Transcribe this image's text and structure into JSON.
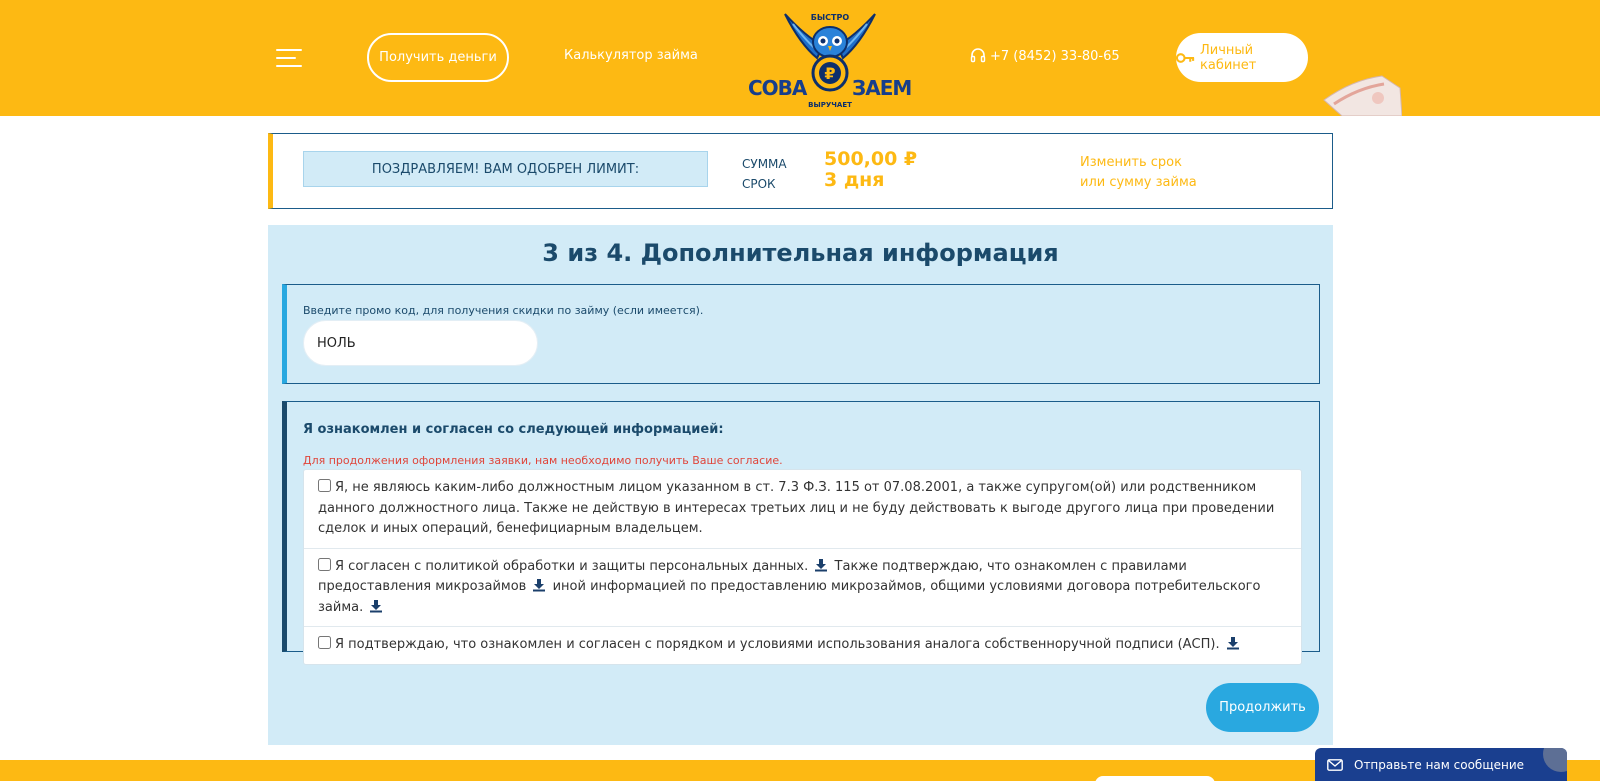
{
  "header": {
    "get_money_label": "Получить деньги",
    "calc_label": "Калькулятор займа",
    "logo": {
      "top": "БЫСТРО",
      "left": "СОВА",
      "right": "ЗАЕМ",
      "bottom": "ВЫРУЧАЕТ",
      "coin": "₽"
    },
    "phone": "+7 (8452) 33-80-65",
    "cabinet_label": "Личный кабинет"
  },
  "limit": {
    "badge": "ПОЗДРАВЛЯЕМ! ВАМ ОДОБРЕН ЛИМИТ:",
    "sum_label": "СУММА",
    "term_label": "СРОК",
    "sum_value": "500,00 ₽",
    "term_value": "3 дня",
    "change_line1": "Изменить срок",
    "change_line2": "или сумму займа"
  },
  "form": {
    "step_title": "3 из 4. Дополнительная информация",
    "promo_label": "Введите промо код, для получения скидки по займу (если имеется).",
    "promo_value": "НОЛЬ",
    "agree_title": "Я ознакомлен и согласен со следующей информацией:",
    "agree_warning": "Для продолжения оформления заявки, нам необходимо получить Ваше согласие.",
    "agree_items": [
      {
        "text": "Я, не являюсь каким-либо должностным лицом указанном в ст. 7.3 Ф.З. 115 от 07.08.2001, а также супругом(ой) или родственником данного должностного лица. Также не действую в интересах третьих лиц и не буду действовать к выгоде другого лица при проведении сделок и иных операций, бенефициарным владельцем."
      },
      {
        "text_a": "Я согласен с политикой обработки и защиты персональных данных.",
        "text_b": "Также подтверждаю, что ознакомлен с правилами предоставления микрозаймов",
        "text_c": "иной информацией по предоставлению микрозаймов, общими условиями договора потребительского займа."
      },
      {
        "text": "Я подтверждаю, что ознакомлен и согласен с порядком и условиями использования аналога собственноручной подписи (АСП)."
      }
    ],
    "continue_label": "Продолжить"
  },
  "chat": {
    "label": "Отправьте нам сообщение"
  },
  "colors": {
    "brand_yellow": "#fdb913",
    "brand_blue": "#29a8e0",
    "dark_blue": "#1b4a6b",
    "panel_bg": "#d2ebf7"
  },
  "icons": [
    "menu-icon",
    "headset-icon",
    "key-icon",
    "download-icon",
    "mail-icon"
  ]
}
